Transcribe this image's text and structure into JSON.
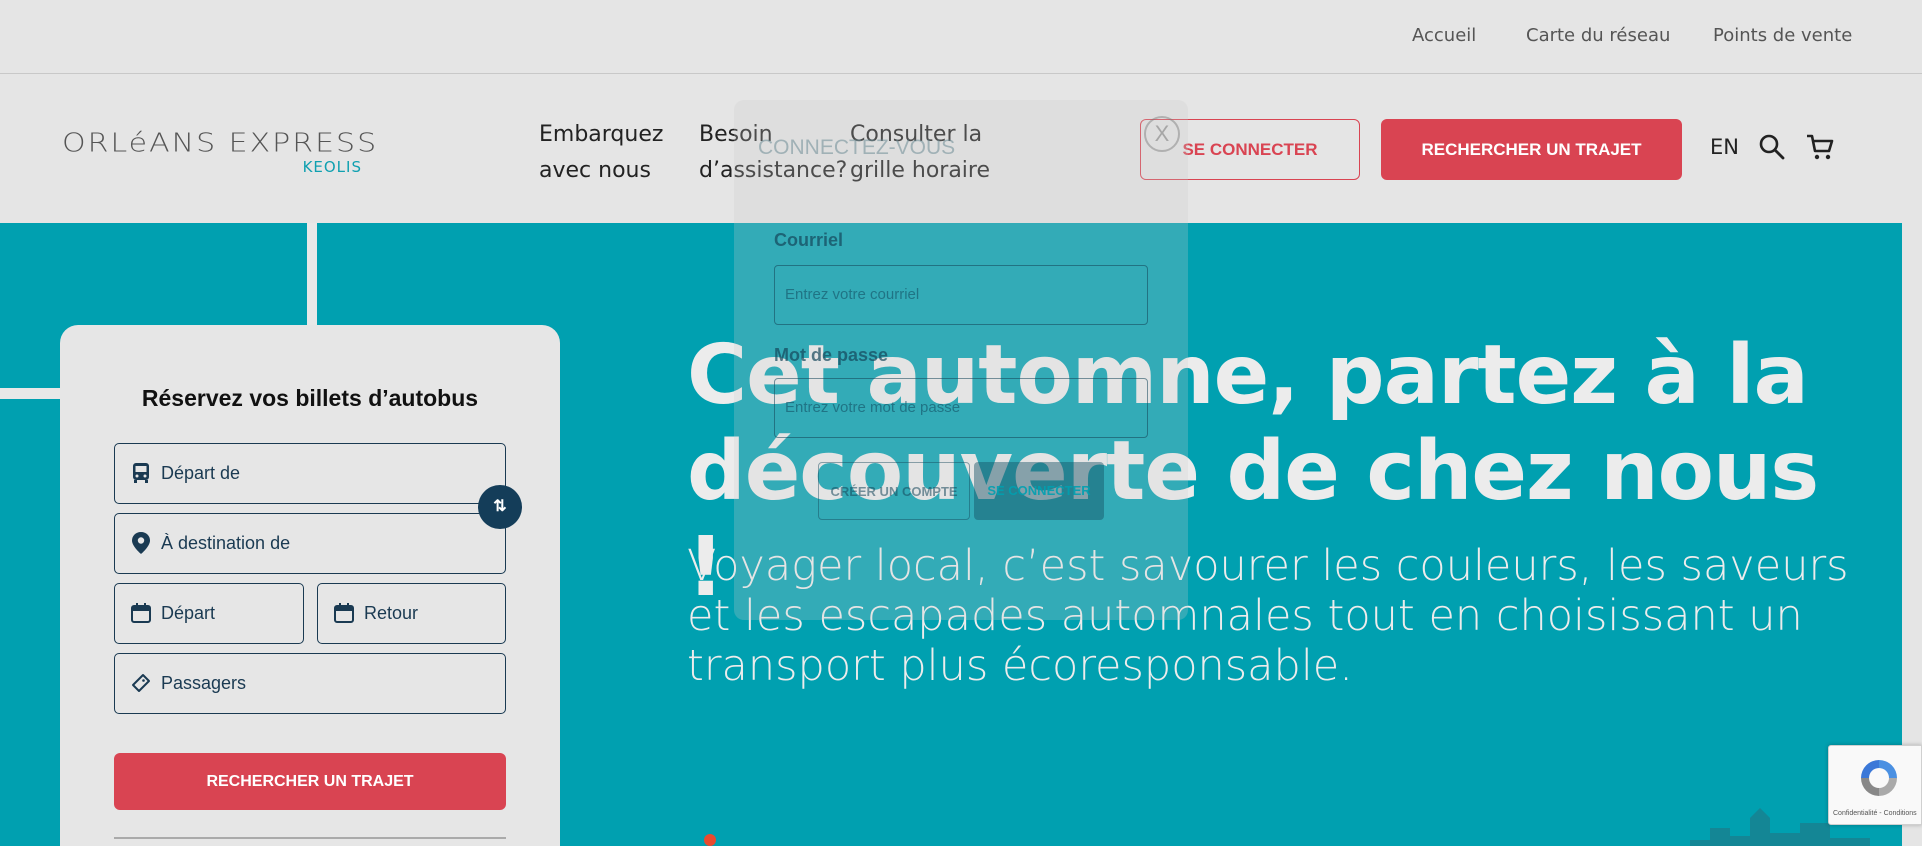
{
  "topbar": {
    "links": [
      "Accueil",
      "Carte du réseau",
      "Points de vente"
    ]
  },
  "header": {
    "logo": {
      "brand": "ORLéANS EXPRESS",
      "sub": "KEOLIS"
    },
    "nav": [
      {
        "line1": "Embarquez",
        "line2": "avec nous"
      },
      {
        "line1": "Besoin",
        "line2": "d’assistance?"
      },
      {
        "line1": "Consulter la",
        "line2": "grille horaire"
      }
    ],
    "login_button": "SE CONNECTER",
    "search_button": "RECHERCHER UN TRAJET",
    "lang": "EN",
    "icons": [
      "search-icon",
      "cart-icon"
    ]
  },
  "hero": {
    "title": "Cet automne, partez à la découverte de chez nous !",
    "subtitle": "Voyager local, c’est savourer les couleurs, les saveurs et les escapades automnales tout en choisissant un transport plus écoresponsable."
  },
  "booking": {
    "title": "Réservez vos billets d’autobus",
    "from": "Départ de",
    "to": "À destination de",
    "depart_date": "Départ",
    "return_date": "Retour",
    "passengers": "Passagers",
    "search_button": "RECHERCHER UN TRAJET",
    "swap_symbol": "⇅"
  },
  "login_modal": {
    "title": "CONNECTEZ-VOUS",
    "close_symbol": "X",
    "email_label": "Courriel",
    "email_placeholder": "Entrez votre courriel",
    "password_label": "Mot de passe",
    "password_placeholder": "Entrez votre mot de passe",
    "create_button": "CRÉER UN COMPTE",
    "login_button": "SE CONNECTER"
  },
  "recaptcha": {
    "text": "Confidentialité - Conditions"
  },
  "colors": {
    "accent_red": "#d94452",
    "teal": "#00a0b0",
    "navy": "#1a3a52"
  }
}
